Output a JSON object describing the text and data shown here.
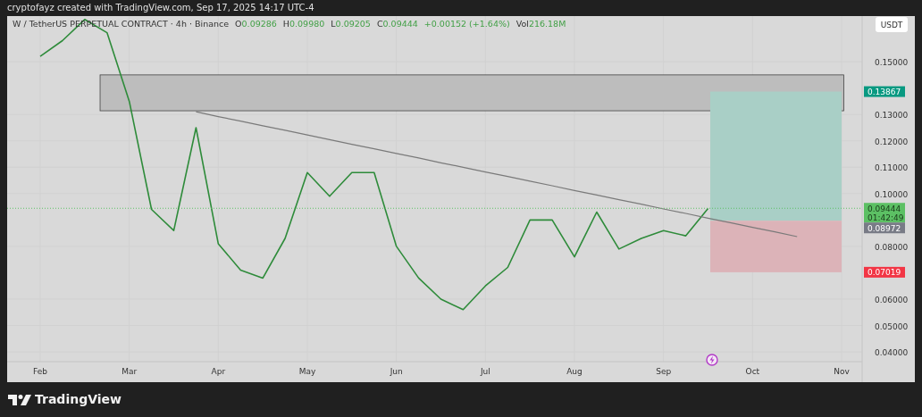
{
  "caption": "cryptofayz created with TradingView.com, Sep 17, 2025 14:17 UTC-4",
  "chart": {
    "legend": {
      "symbol": "W / TetherUS PERPETUAL CONTRACT · 4h · Binance",
      "ohlc": [
        {
          "label": "O",
          "value": "0.09286"
        },
        {
          "label": "H",
          "value": "0.09980"
        },
        {
          "label": "L",
          "value": "0.09205"
        },
        {
          "label": "C",
          "value": "0.09444"
        }
      ],
      "change": "+0.00152 (+1.64%)",
      "volume_label": "Vol",
      "volume": "216.18M"
    },
    "price_axis": {
      "unit": "USDT"
    },
    "price_tags": [
      {
        "kind": "target",
        "label": "0.13867",
        "color": "#089981"
      },
      {
        "kind": "last",
        "label": "0.09444",
        "sublabel": "01:42:49",
        "color": "#5cc064"
      },
      {
        "kind": "entry",
        "label": "0.08972",
        "color": "#787b86"
      },
      {
        "kind": "stop",
        "label": "0.07019",
        "color": "#f23645"
      }
    ],
    "chart_data": {
      "type": "line",
      "grid": true,
      "ylim": [
        0.0363,
        0.1673
      ],
      "categories": [
        "Feb",
        null,
        null,
        null,
        "Mar",
        null,
        null,
        null,
        "Apr",
        null,
        null,
        null,
        "May",
        null,
        null,
        null,
        "Jun",
        null,
        null,
        null,
        "Jul",
        null,
        null,
        null,
        "Aug",
        null,
        null,
        null,
        "Sep",
        null,
        null,
        null,
        "Oct",
        null,
        null,
        null,
        "Nov"
      ],
      "yticks": [
        {
          "value": 0.15,
          "label": "0.15000"
        },
        {
          "value": 0.13,
          "label": "0.13000"
        },
        {
          "value": 0.12,
          "label": "0.12000"
        },
        {
          "value": 0.11,
          "label": "0.11000"
        },
        {
          "value": 0.1,
          "label": "0.10000"
        },
        {
          "value": 0.08,
          "label": "0.08000"
        },
        {
          "value": 0.06,
          "label": "0.06000"
        },
        {
          "value": 0.05,
          "label": "0.05000"
        },
        {
          "value": 0.04,
          "label": "0.04000"
        }
      ],
      "series": [
        {
          "color": "#2e8b3a",
          "values": [
            0.152,
            0.158,
            0.166,
            0.161,
            0.135,
            0.094,
            0.086,
            0.125,
            0.081,
            0.071,
            0.068,
            0.083,
            0.108,
            0.099,
            0.108,
            0.108,
            0.08,
            0.068,
            0.06,
            0.056,
            0.065,
            0.072,
            0.09,
            0.09,
            0.076,
            0.093,
            0.079,
            0.083,
            0.086,
            0.084,
            0.0944,
            null,
            null,
            null,
            null,
            null,
            null
          ]
        },
        {
          "color": "#7a7a7a",
          "values": [
            null,
            null,
            null,
            null,
            null,
            null,
            null,
            0.131,
            0.1292,
            0.1275,
            0.1257,
            0.124,
            0.1222,
            0.1205,
            0.1187,
            0.117,
            0.1152,
            0.1135,
            0.1117,
            0.11,
            0.1082,
            0.1065,
            0.1047,
            0.103,
            0.1012,
            0.0995,
            0.0977,
            0.096,
            0.0942,
            0.0925,
            0.0907,
            0.089,
            0.0872,
            0.0855,
            0.0837,
            null,
            null
          ]
        }
      ],
      "ref_lines": [
        {
          "axis": "y",
          "value": 0.09444,
          "color": "#5cc064"
        }
      ]
    }
  },
  "brand": "TradingView"
}
